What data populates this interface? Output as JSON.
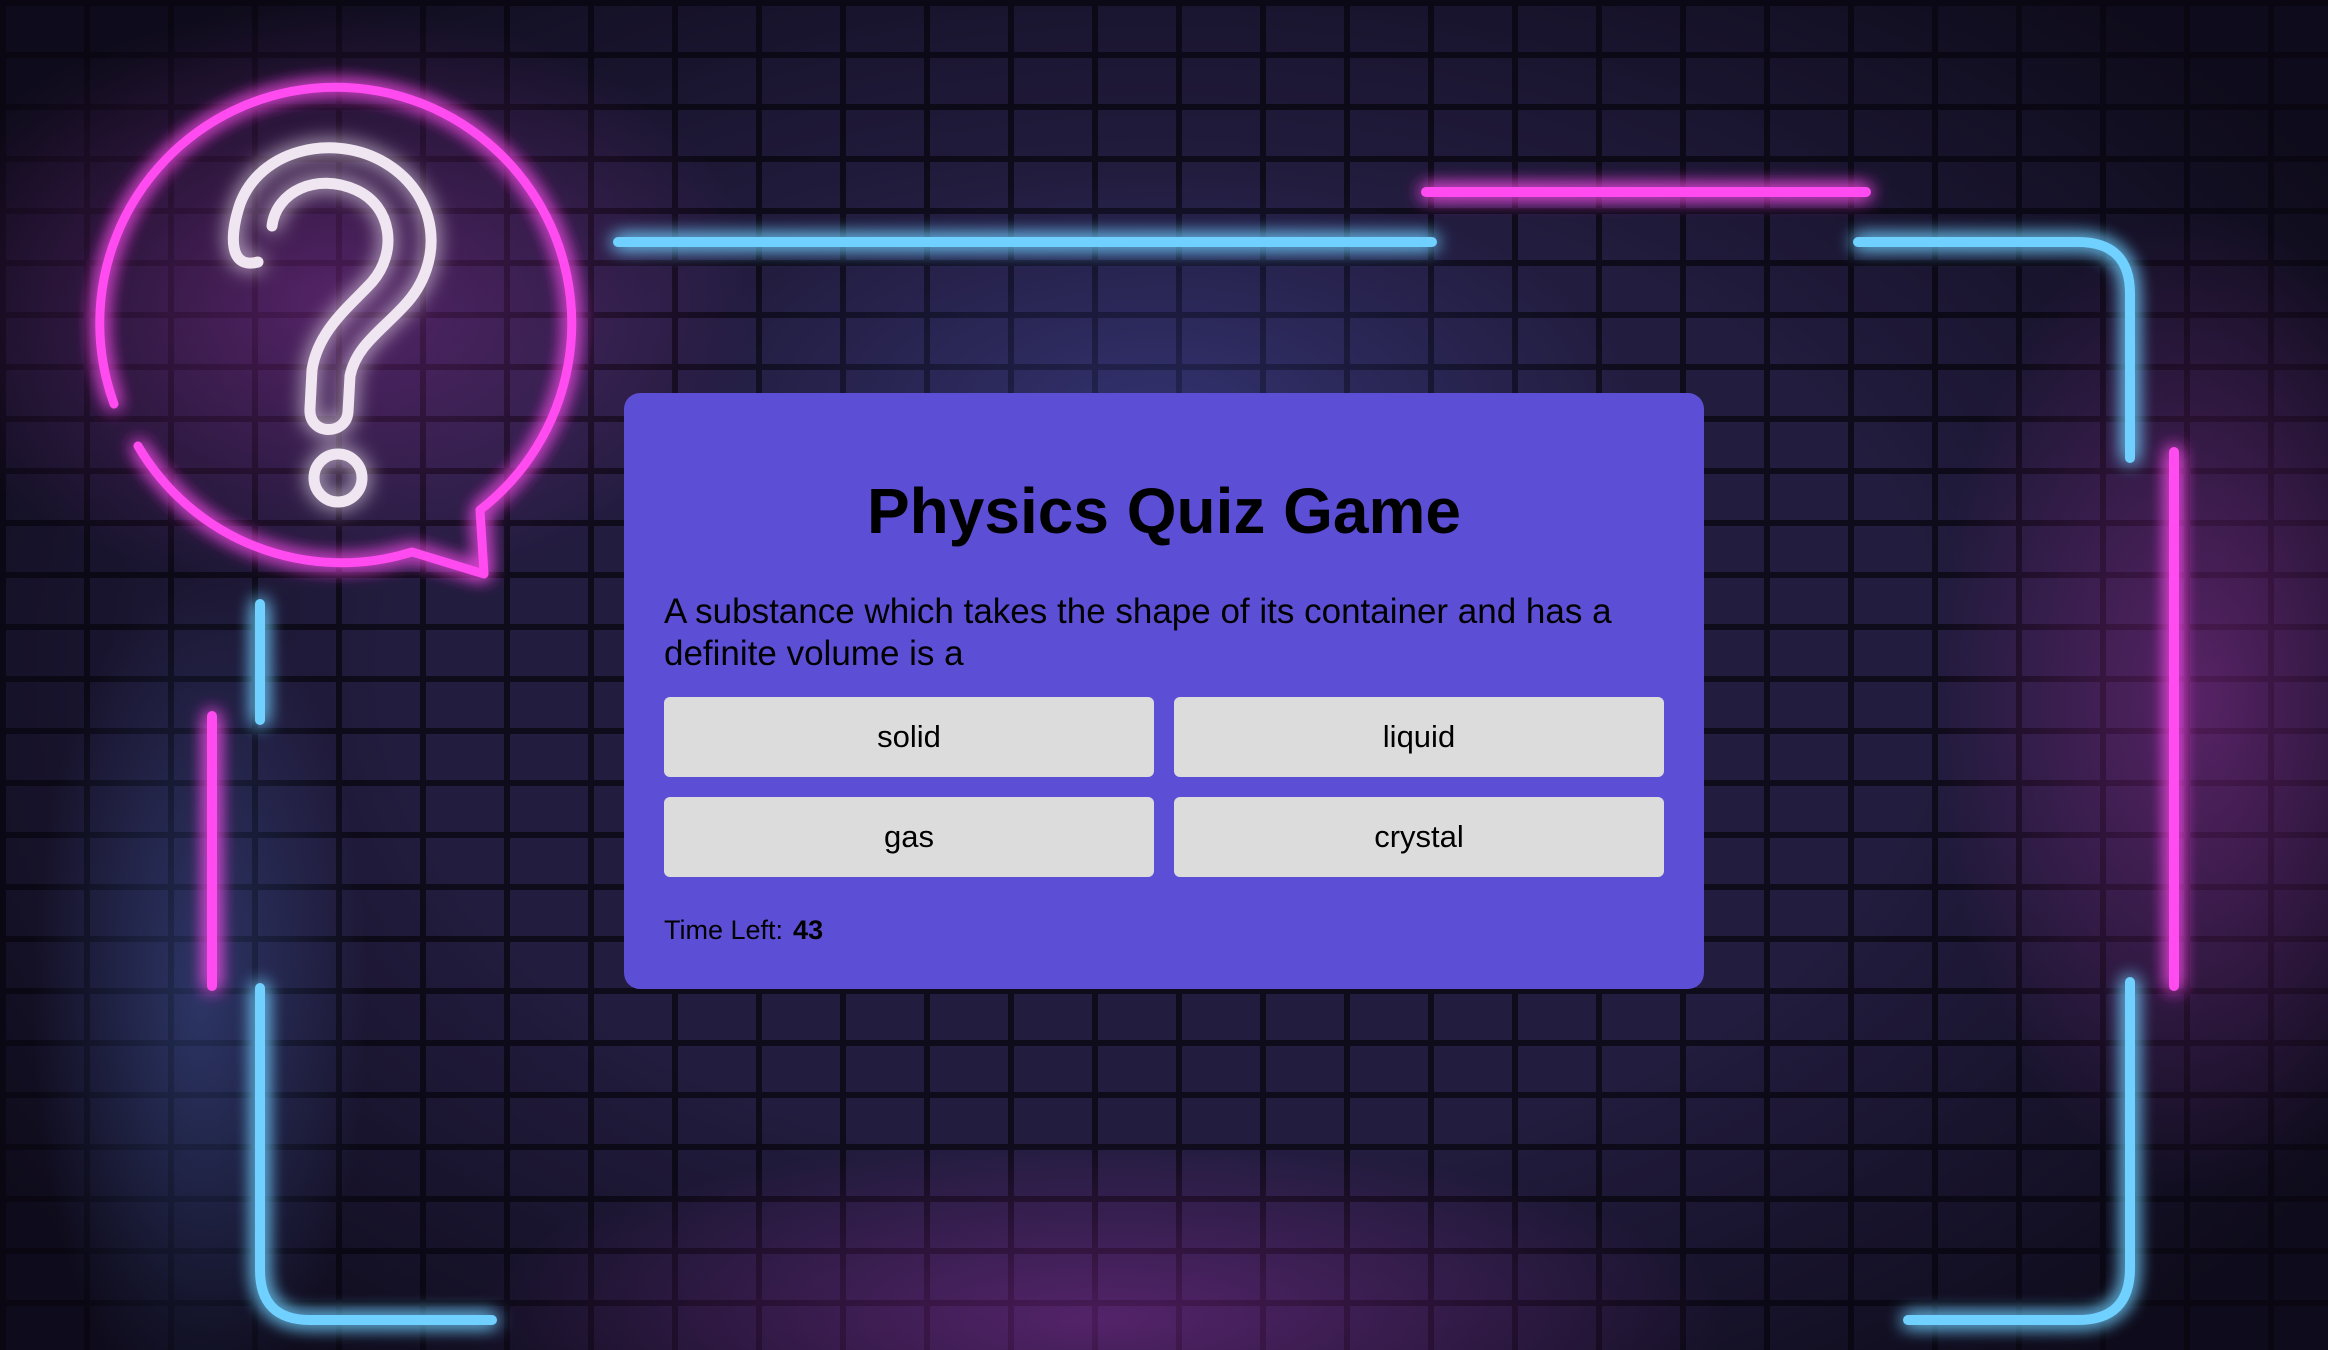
{
  "quiz": {
    "title": "Physics Quiz Game",
    "question": "A substance which takes the shape of its container and has a definite volume is a",
    "answers": [
      "solid",
      "liquid",
      "gas",
      "crystal"
    ],
    "timer_label": "Time Left:",
    "timer_value": "43"
  },
  "colors": {
    "card_background": "#5c4fd5",
    "answer_button": "#dcdcdc",
    "neon_pink": "#ff4bf0",
    "neon_blue": "#6fd0ff"
  },
  "icons": {
    "decoration": "neon-question-speech-bubble-icon"
  }
}
